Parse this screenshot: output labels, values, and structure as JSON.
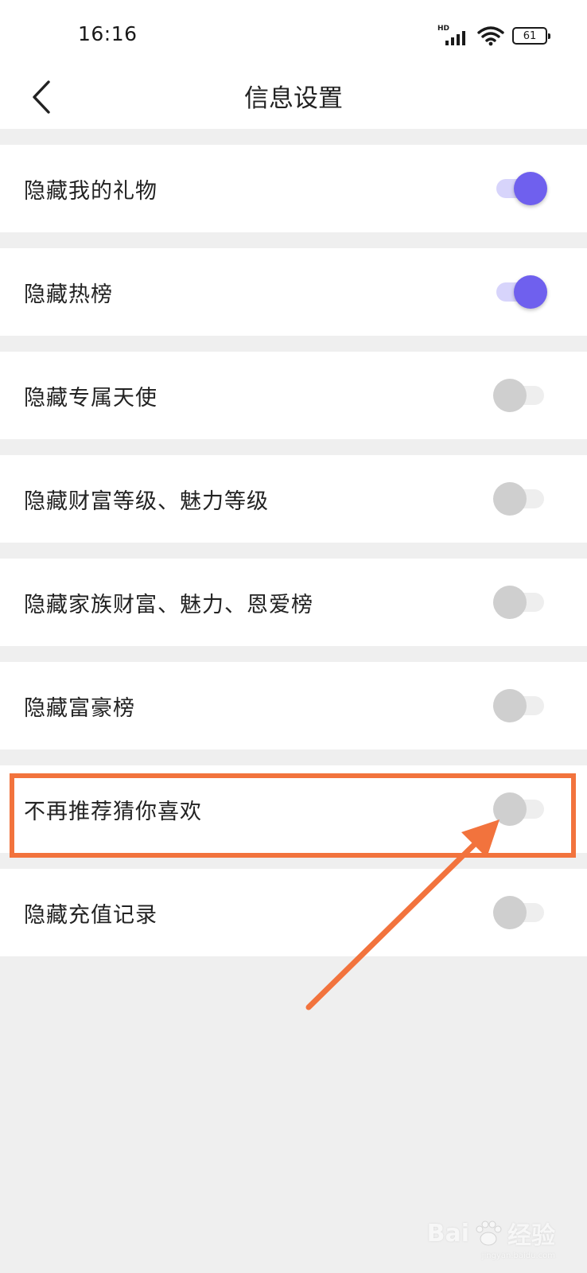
{
  "status_bar": {
    "time": "16:16",
    "network": "HD",
    "battery": "61"
  },
  "header": {
    "title": "信息设置"
  },
  "settings": [
    {
      "label": "隐藏我的礼物",
      "on": true
    },
    {
      "label": "隐藏热榜",
      "on": true
    },
    {
      "label": "隐藏专属天使",
      "on": false
    },
    {
      "label": "隐藏财富等级、魅力等级",
      "on": false
    },
    {
      "label": "隐藏家族财富、魅力、恩爱榜",
      "on": false
    },
    {
      "label": "隐藏富豪榜",
      "on": false
    },
    {
      "label": "不再推荐猜你喜欢",
      "on": false
    },
    {
      "label": "隐藏充值记录",
      "on": false
    }
  ],
  "colors": {
    "accent": "#6f60ee",
    "accent_track": "#d7d4fb",
    "annotation": "#f2733d"
  },
  "watermark": {
    "brand": "Bai",
    "brand_cn": "经验",
    "sub": "jingyan.baidu.com"
  }
}
